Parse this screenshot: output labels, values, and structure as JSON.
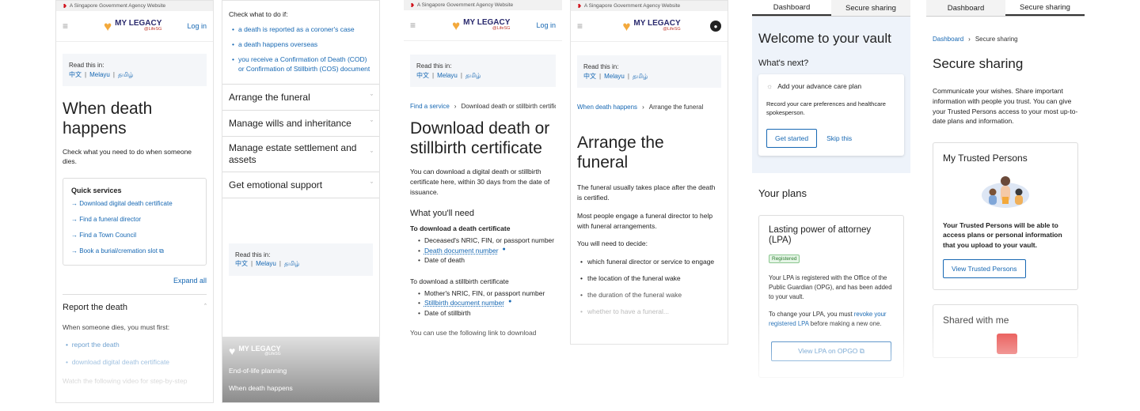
{
  "gov_banner": "A Singapore Government Agency Website",
  "logo": {
    "name": "MY LEGACY",
    "sub": "@LifeSG"
  },
  "login_label": "Log in",
  "lang": {
    "prompt": "Read this in:",
    "options": [
      "中文",
      "Melayu",
      "தமிழ்"
    ]
  },
  "p1": {
    "title": "When death happens",
    "intro": "Check what you need to do when someone dies.",
    "qs_title": "Quick services",
    "qs_items": [
      "Download digital death certificate",
      "Find a funeral director",
      "Find a Town Council",
      "Book a burial/cremation slot"
    ],
    "expand_all": "Expand all",
    "report_title": "Report the death",
    "report_text": "When someone dies, you must first:",
    "report_links": [
      "report the death",
      "download digital death certificate"
    ],
    "video_text": "Watch the following video for step-by-step"
  },
  "p2": {
    "check_title": "Check what to do if:",
    "check_items": [
      "a death is reported as a coroner's case",
      "a death happens overseas",
      "you receive a Confirmation of Death (COD) or Confirmation of Stillbirth (COS) document"
    ],
    "accordion": [
      "Arrange the funeral",
      "Manage wills and inheritance",
      "Manage estate settlement and assets",
      "Get emotional support"
    ],
    "footer_links": [
      "End-of-life planning",
      "When death happens"
    ]
  },
  "p3": {
    "crumb_link": "Find a service",
    "crumb_current": "Download death or stillbirth certificate",
    "title": "Download death or stillbirth certificate",
    "intro": "You can download a digital death or stillbirth certificate here, within 30 days from the date of issuance.",
    "need_title": "What you'll need",
    "death_sub": "To download a death certificate",
    "death_items": [
      "Deceased's NRIC, FIN, or passport number",
      "Death document number",
      "Date of death"
    ],
    "still_sub": "To download a stillbirth certificate",
    "still_items": [
      "Mother's NRIC, FIN, or passport number",
      "Stillbirth document number",
      "Date of stillbirth"
    ],
    "tail": "You can use the following link to download"
  },
  "p4": {
    "crumb_link": "When death happens",
    "crumb_current": "Arrange the funeral",
    "title": "Arrange the funeral",
    "p1": "The funeral usually takes place after the death is certified.",
    "p2": "Most people engage a funeral director to help with funeral arrangements.",
    "p3": "You will need to decide:",
    "items": [
      "which funeral director or service to engage",
      "the location of the funeral wake",
      "the duration of the funeral wake",
      "whether to have a funeral..."
    ]
  },
  "tabs": {
    "dashboard": "Dashboard",
    "secure": "Secure sharing"
  },
  "p5": {
    "title": "Welcome to your vault",
    "next": "What's next?",
    "card_title": "Add your advance care plan",
    "card_text": "Record your care preferences and healthcare spokesperson.",
    "get_started": "Get started",
    "skip": "Skip this",
    "plans": "Your plans",
    "lpa_title": "Lasting power of attorney (LPA)",
    "badge": "Registered",
    "lpa_text": "Your LPA is registered with the Office of the Public Guardian (OPG), and has been added to your vault.",
    "change_pre": "To change your LPA, you must ",
    "change_link": "revoke your registered LPA",
    "change_post": " before making a new one.",
    "opg_btn": "View LPA on OPGO"
  },
  "p6": {
    "crumb_link": "Dashboard",
    "crumb_current": "Secure sharing",
    "title": "Secure sharing",
    "intro": "Communicate your wishes. Share important information with people you trust. You can give your Trusted Persons access to your most up-to-date plans and information.",
    "tp_title": "My Trusted Persons",
    "tp_text": "Your Trusted Persons will be able to access plans or personal information that you upload to your vault.",
    "tp_btn": "View Trusted Persons",
    "shared": "Shared with me"
  },
  "colors": {
    "link": "#1768b3",
    "brand_navy": "#2a2a6e",
    "heart": "#f3a93c",
    "badge_green": "#2e7d32"
  }
}
